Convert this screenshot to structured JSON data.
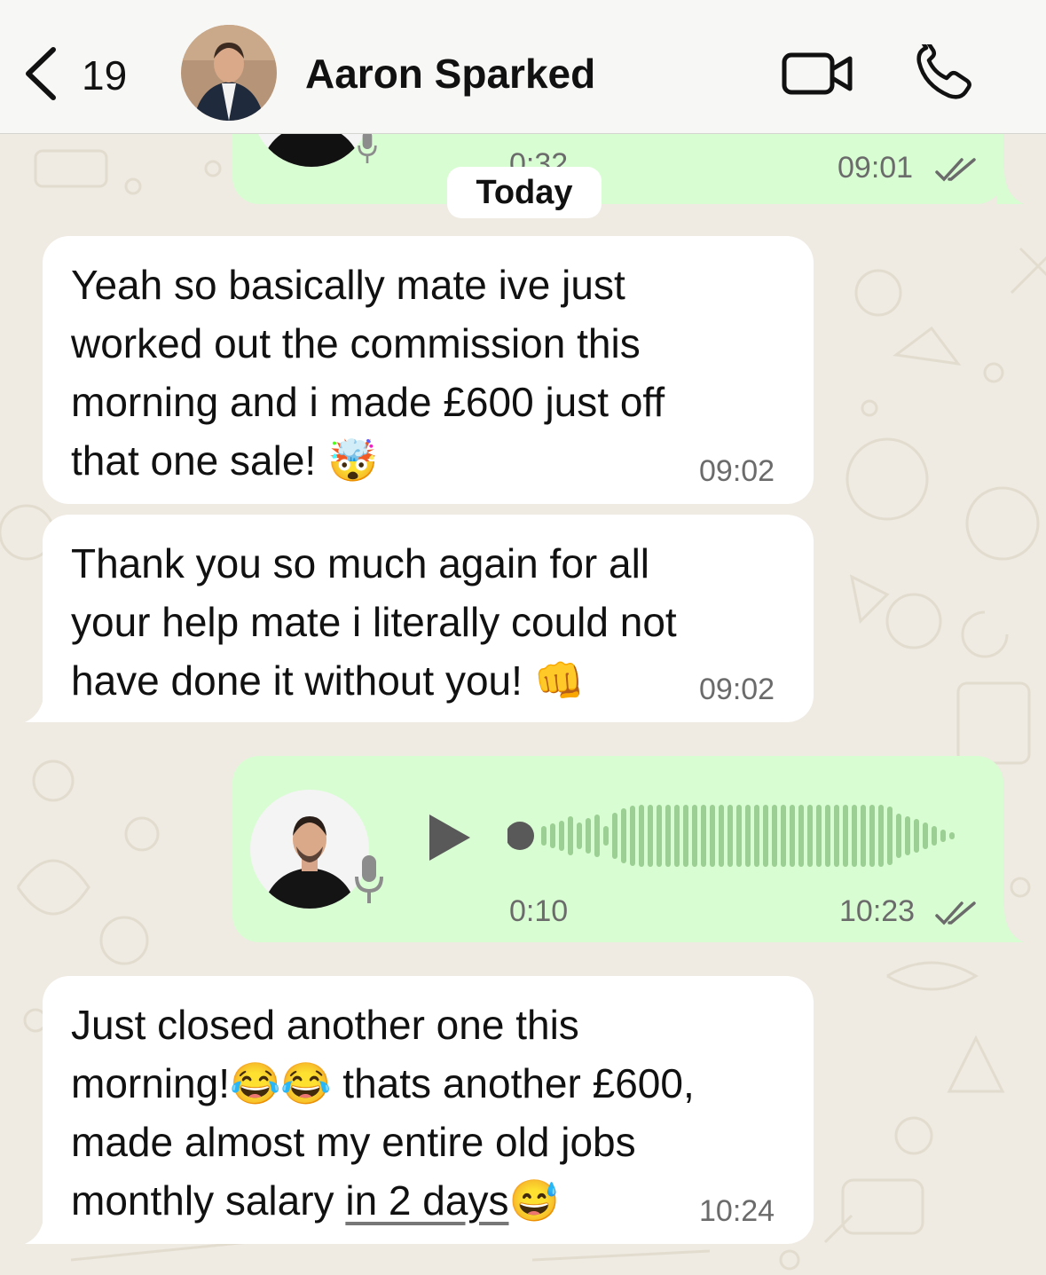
{
  "header": {
    "unread_count": "19",
    "contact_name": "Aaron Sparked"
  },
  "previous_voice": {
    "duration": "0:32",
    "time": "09:01",
    "status": "read"
  },
  "date_separator": "Today",
  "messages": [
    {
      "direction": "incoming",
      "text": "Yeah so basically mate ive just\nworked out the commission this\nmorning and i made £600 just off\nthat one sale! ",
      "emoji": "🤯",
      "time": "09:02"
    },
    {
      "direction": "incoming",
      "text": "Thank you so much again for all\nyour help mate i literally could not\nhave done it without you! ",
      "emoji": "👊",
      "time": "09:02"
    },
    {
      "direction": "outgoing",
      "type": "voice",
      "duration": "0:10",
      "time": "10:23",
      "status": "read",
      "icon": "play-icon"
    },
    {
      "direction": "incoming",
      "text_before": "Just closed another one this\nmorning!",
      "emoji_1": "😂😂",
      "text_middle": " thats another £600,\nmade almost my entire old jobs\nmonthly salary ",
      "link_text": "in 2 days",
      "emoji_2": "😅",
      "time": "10:24"
    }
  ],
  "colors": {
    "background": "#efeae2",
    "incoming_bubble": "#ffffff",
    "outgoing_bubble": "#d9fdd3",
    "read_ticks": "#6b6b6b",
    "waveform": "#9ccf93"
  }
}
